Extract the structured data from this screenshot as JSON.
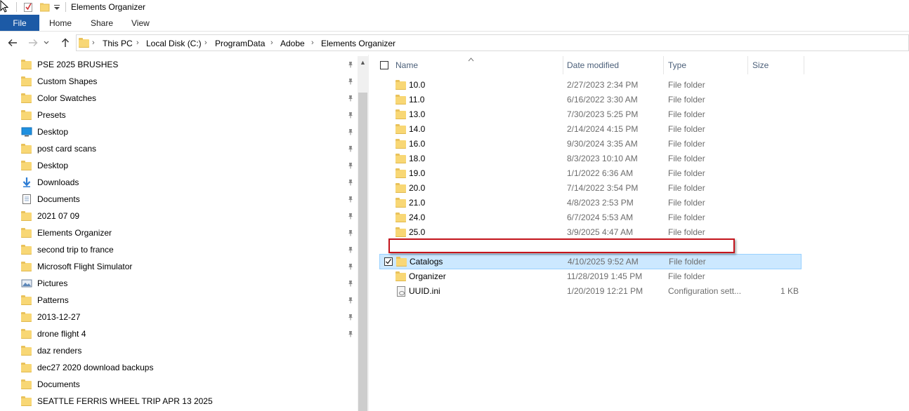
{
  "window": {
    "title": "Elements Organizer"
  },
  "ribbon": {
    "file": "File",
    "tabs": [
      "Home",
      "Share",
      "View"
    ]
  },
  "address": {
    "crumbs": [
      "This PC",
      "Local Disk (C:)",
      "ProgramData",
      "Adobe",
      "Elements Organizer"
    ]
  },
  "nav": {
    "items": [
      {
        "label": "PSE 2025 BRUSHES",
        "icon": "folder-icon",
        "pinned": true
      },
      {
        "label": "Custom Shapes",
        "icon": "folder-icon",
        "pinned": true
      },
      {
        "label": "Color Swatches",
        "icon": "folder-icon",
        "pinned": true
      },
      {
        "label": "Presets",
        "icon": "folder-icon",
        "pinned": true
      },
      {
        "label": "Desktop",
        "icon": "desktop-icon",
        "pinned": true
      },
      {
        "label": "post card scans",
        "icon": "folder-icon",
        "pinned": true
      },
      {
        "label": "Desktop",
        "icon": "folder-icon",
        "pinned": true
      },
      {
        "label": "Downloads",
        "icon": "download-icon",
        "pinned": true
      },
      {
        "label": "Documents",
        "icon": "documents-icon",
        "pinned": true
      },
      {
        "label": "2021 07 09",
        "icon": "folder-icon",
        "pinned": true
      },
      {
        "label": "Elements Organizer",
        "icon": "folder-icon",
        "pinned": true
      },
      {
        "label": "second trip to france",
        "icon": "folder-icon",
        "pinned": true
      },
      {
        "label": "Microsoft Flight Simulator",
        "icon": "folder-icon",
        "pinned": true
      },
      {
        "label": "Pictures",
        "icon": "pictures-icon",
        "pinned": true
      },
      {
        "label": "Patterns",
        "icon": "folder-icon",
        "pinned": true
      },
      {
        "label": "2013-12-27",
        "icon": "folder-icon",
        "pinned": true
      },
      {
        "label": "drone flight 4",
        "icon": "folder-icon",
        "pinned": true
      },
      {
        "label": "daz renders",
        "icon": "folder-icon",
        "pinned": false
      },
      {
        "label": "dec27 2020 download backups",
        "icon": "folder-icon",
        "pinned": false
      },
      {
        "label": "Documents",
        "icon": "folder-icon",
        "pinned": false
      },
      {
        "label": "SEATTLE FERRIS WHEEL TRIP APR 13 2025",
        "icon": "folder-icon",
        "pinned": false
      }
    ]
  },
  "columns": {
    "name": "Name",
    "date": "Date modified",
    "type": "Type",
    "size": "Size"
  },
  "files": [
    {
      "name": "10.0",
      "date": "2/27/2023 2:34 PM",
      "type": "File folder",
      "size": "",
      "icon": "folder-icon"
    },
    {
      "name": "11.0",
      "date": "6/16/2022 3:30 AM",
      "type": "File folder",
      "size": "",
      "icon": "folder-icon"
    },
    {
      "name": "13.0",
      "date": "7/30/2023 5:25 PM",
      "type": "File folder",
      "size": "",
      "icon": "folder-icon"
    },
    {
      "name": "14.0",
      "date": "2/14/2024 4:15 PM",
      "type": "File folder",
      "size": "",
      "icon": "folder-icon"
    },
    {
      "name": "16.0",
      "date": "9/30/2024 3:35 AM",
      "type": "File folder",
      "size": "",
      "icon": "folder-icon"
    },
    {
      "name": "18.0",
      "date": "8/3/2023 10:10 AM",
      "type": "File folder",
      "size": "",
      "icon": "folder-icon"
    },
    {
      "name": "19.0",
      "date": "1/1/2022 6:36 AM",
      "type": "File folder",
      "size": "",
      "icon": "folder-icon"
    },
    {
      "name": "20.0",
      "date": "7/14/2022 3:54 PM",
      "type": "File folder",
      "size": "",
      "icon": "folder-icon"
    },
    {
      "name": "21.0",
      "date": "4/8/2023 2:53 PM",
      "type": "File folder",
      "size": "",
      "icon": "folder-icon"
    },
    {
      "name": "24.0",
      "date": "6/7/2024 5:53 AM",
      "type": "File folder",
      "size": "",
      "icon": "folder-icon"
    },
    {
      "name": "25.0",
      "date": "3/9/2025 4:47 AM",
      "type": "File folder",
      "size": "",
      "icon": "folder-icon"
    },
    {
      "name": "",
      "date": "",
      "type": "",
      "size": "",
      "icon": "none"
    },
    {
      "name": "Catalogs",
      "date": "4/10/2025 9:52 AM",
      "type": "File folder",
      "size": "",
      "icon": "folder-icon",
      "selected": true
    },
    {
      "name": "Organizer",
      "date": "11/28/2019 1:45 PM",
      "type": "File folder",
      "size": "",
      "icon": "folder-icon"
    },
    {
      "name": "UUID.ini",
      "date": "1/20/2019 12:21 PM",
      "type": "Configuration sett...",
      "size": "1 KB",
      "icon": "ini-file-icon"
    }
  ]
}
